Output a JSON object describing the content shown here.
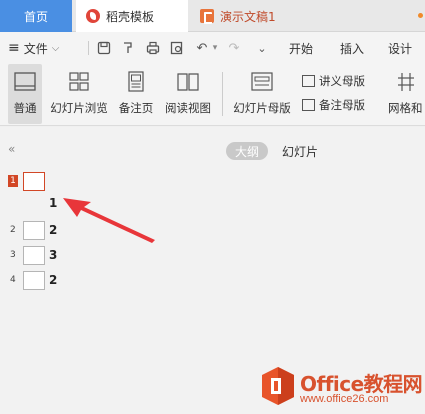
{
  "tabs": {
    "home": "首页",
    "template": "稻壳模板",
    "document": "演示文稿1"
  },
  "menu": {
    "file": "文件",
    "start": "开始",
    "insert": "插入",
    "design": "设计"
  },
  "ribbon": {
    "normal": "普通",
    "slide_browse": "幻灯片浏览",
    "notes_page": "备注页",
    "reading_view": "阅读视图",
    "slide_master": "幻灯片母版",
    "handout_master": "讲义母版",
    "notes_master": "备注母版",
    "grid": "网格和"
  },
  "panel": {
    "collapse_icon": "«",
    "tab_outline": "大纲",
    "tab_slides": "幻灯片",
    "rows": [
      {
        "num": "1",
        "text": "1",
        "selected": true
      },
      {
        "num": "2",
        "text": "2",
        "selected": false
      },
      {
        "num": "3",
        "text": "3",
        "selected": false
      },
      {
        "num": "4",
        "text": "2",
        "selected": false
      }
    ]
  },
  "watermark": {
    "name": "Office教程网",
    "url": "www.office26.com"
  },
  "colors": {
    "accent": "#d24726",
    "home_tab": "#4a8fe3",
    "arrow": "#e8363a"
  }
}
